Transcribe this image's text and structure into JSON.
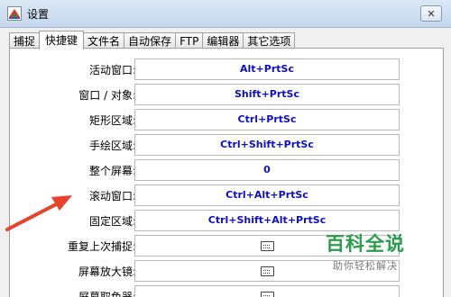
{
  "window": {
    "title": "设置",
    "close_glyph": "✕"
  },
  "tabs": [
    {
      "label": "捕捉",
      "active": false
    },
    {
      "label": "快捷键",
      "active": true
    },
    {
      "label": "文件名",
      "active": false
    },
    {
      "label": "自动保存",
      "active": false
    },
    {
      "label": "FTP",
      "active": false
    },
    {
      "label": "编辑器",
      "active": false
    },
    {
      "label": "其它选项",
      "active": false
    }
  ],
  "hotkeys": [
    {
      "label": "活动窗口:",
      "value": "Alt+PrtSc"
    },
    {
      "label": "窗口 / 对象:",
      "value": "Shift+PrtSc"
    },
    {
      "label": "矩形区域:",
      "value": "Ctrl+PrtSc"
    },
    {
      "label": "手绘区域:",
      "value": "Ctrl+Shift+PrtSc"
    },
    {
      "label": "整个屏幕:",
      "value": "0"
    },
    {
      "label": "滚动窗口:",
      "value": "Ctrl+Alt+PrtSc"
    },
    {
      "label": "固定区域:",
      "value": "Ctrl+Shift+Alt+PrtSc"
    },
    {
      "label": "重复上次捕捉:",
      "value": "",
      "icon": "keyboard-icon"
    },
    {
      "label": "屏幕放大镜:",
      "value": "",
      "icon": "keyboard-icon"
    },
    {
      "label": "屏幕取色器:",
      "value": "",
      "icon": "keyboard-icon"
    }
  ],
  "annotation": {
    "arrow_color": "#e8412c"
  },
  "watermark": {
    "title": "百科全说",
    "subtitle": "助你轻松解决"
  }
}
